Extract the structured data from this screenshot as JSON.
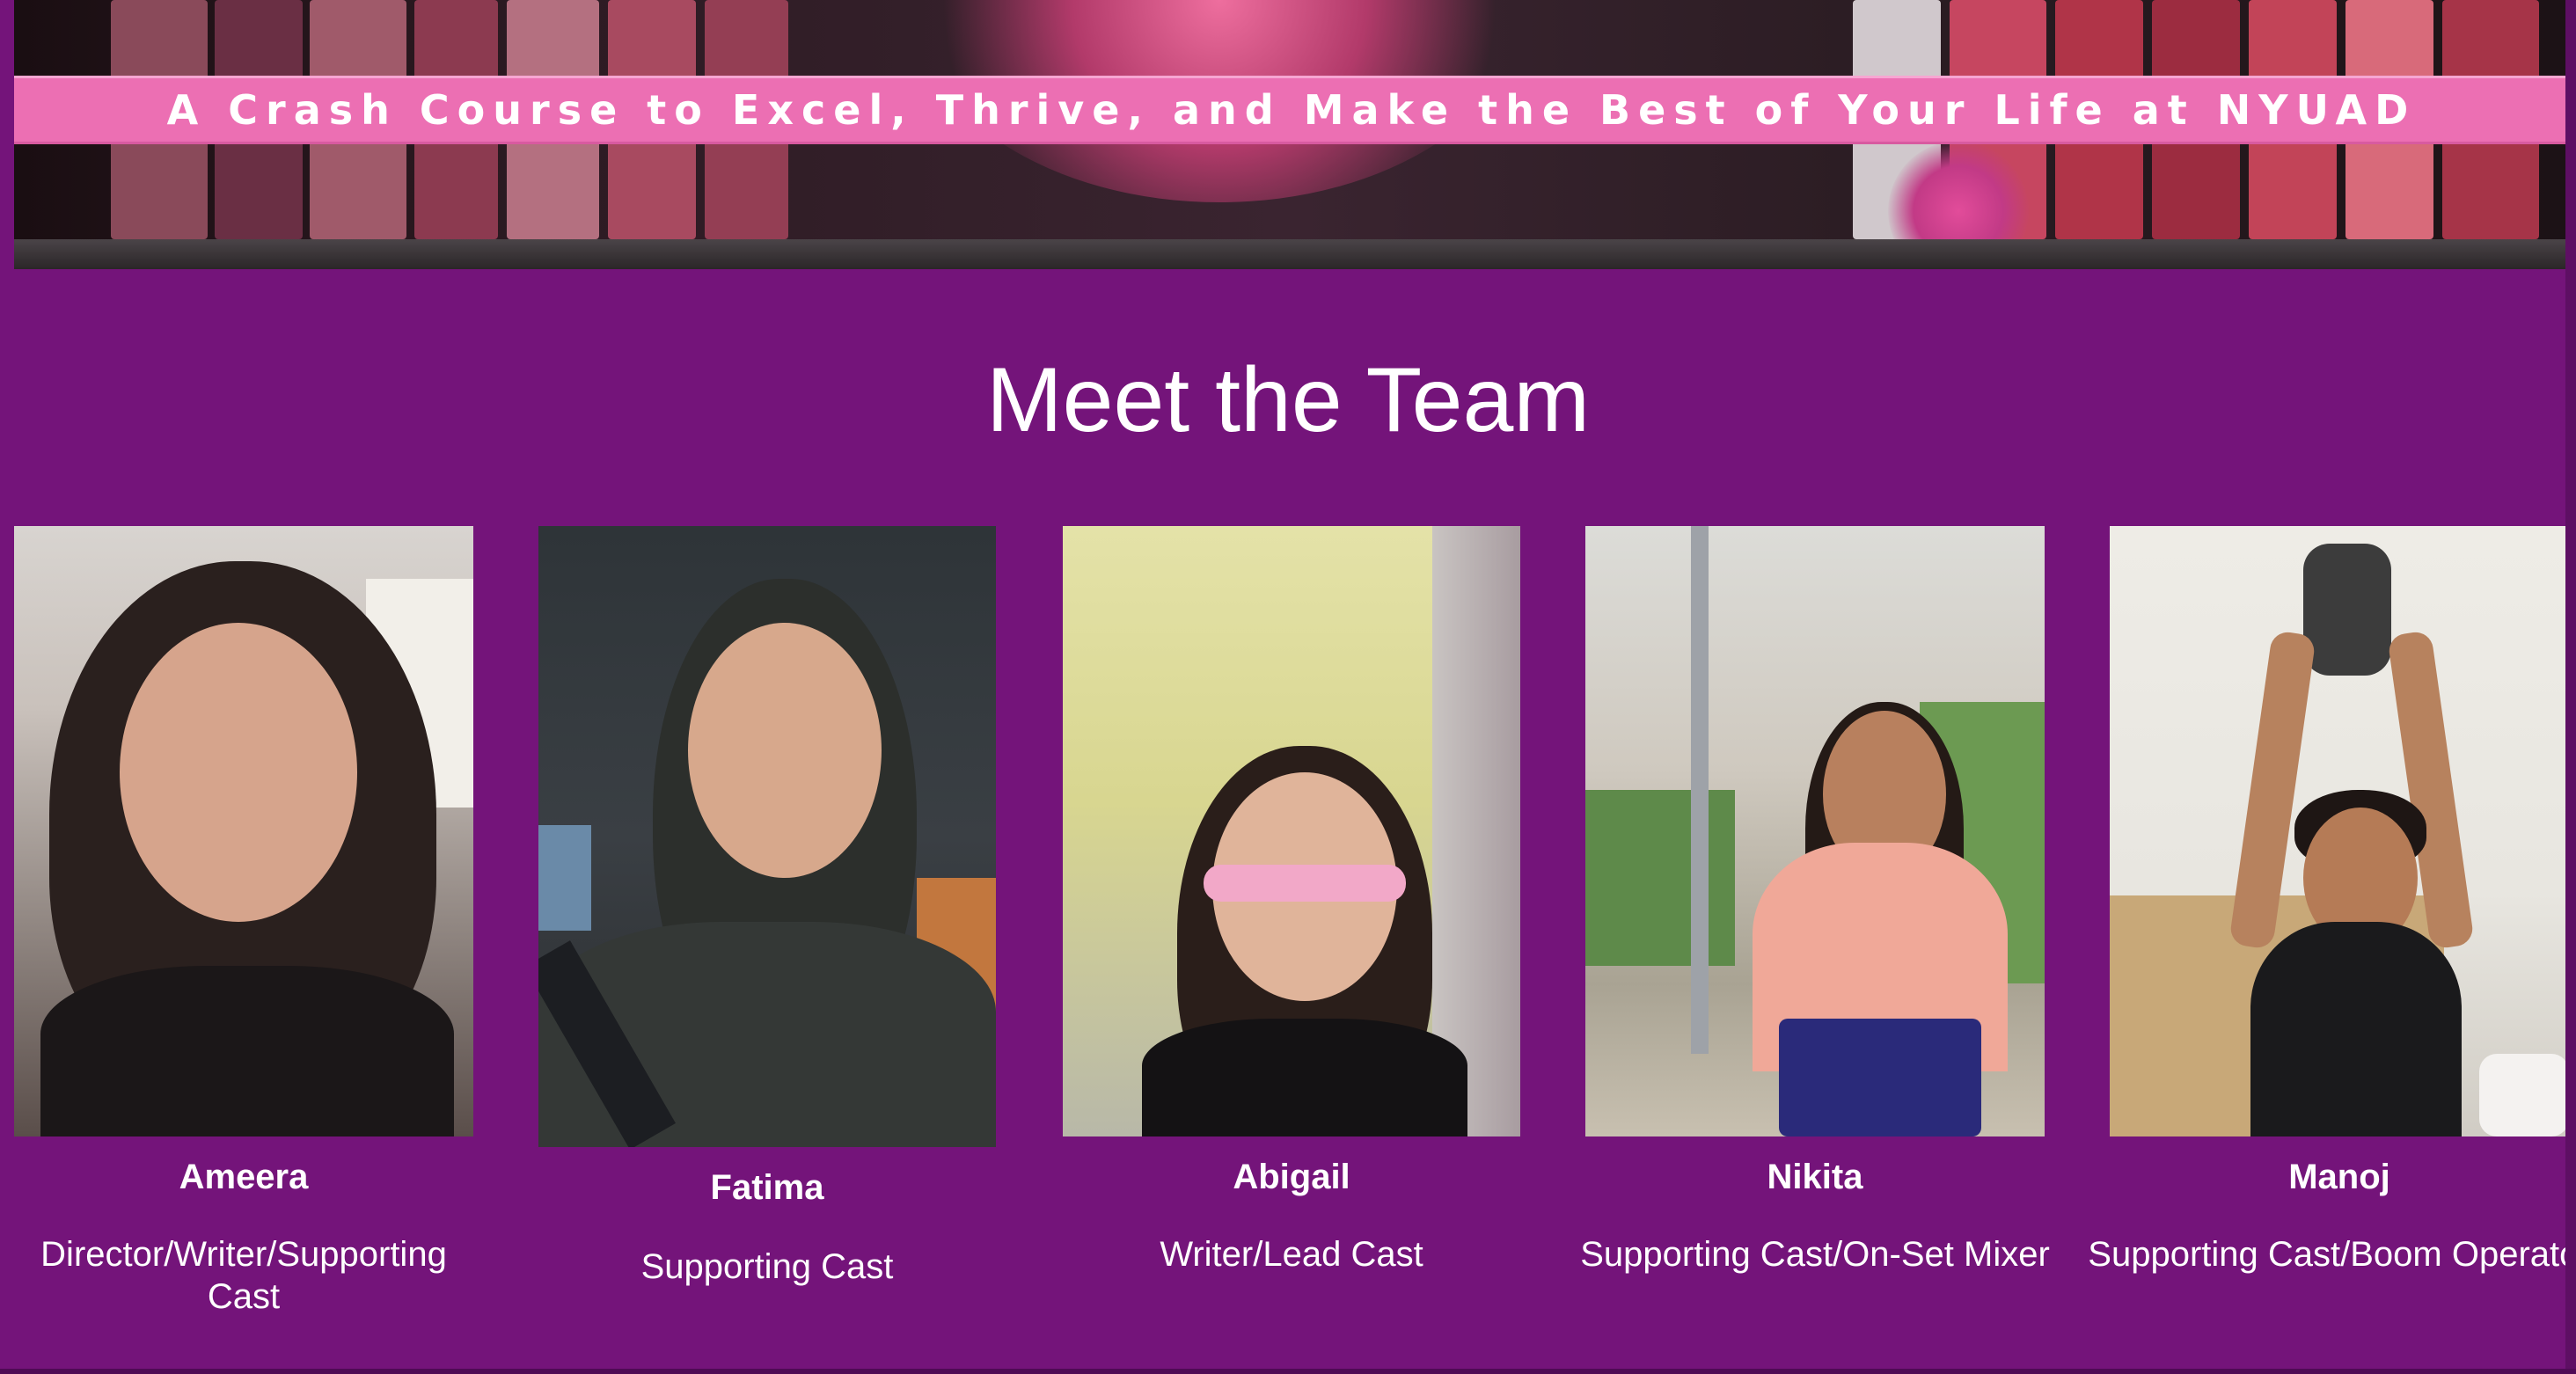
{
  "hero": {
    "tagline": "A Crash Course to Excel, Thrive, and Make the Best of Your Life at NYUAD"
  },
  "heading": "Meet the Team",
  "colors": {
    "background": "#74147a",
    "banner_bar": "#ec6fb3",
    "text": "#ffffff"
  },
  "team": [
    {
      "name": "Ameera",
      "role": "Director/Writer/Supporting Cast"
    },
    {
      "name": "Fatima",
      "role": "Supporting Cast"
    },
    {
      "name": "Abigail",
      "role": "Writer/Lead Cast"
    },
    {
      "name": "Nikita",
      "role": "Supporting Cast/On-Set Mixer"
    },
    {
      "name": "Manoj",
      "role": "Supporting Cast/Boom Operator"
    }
  ]
}
